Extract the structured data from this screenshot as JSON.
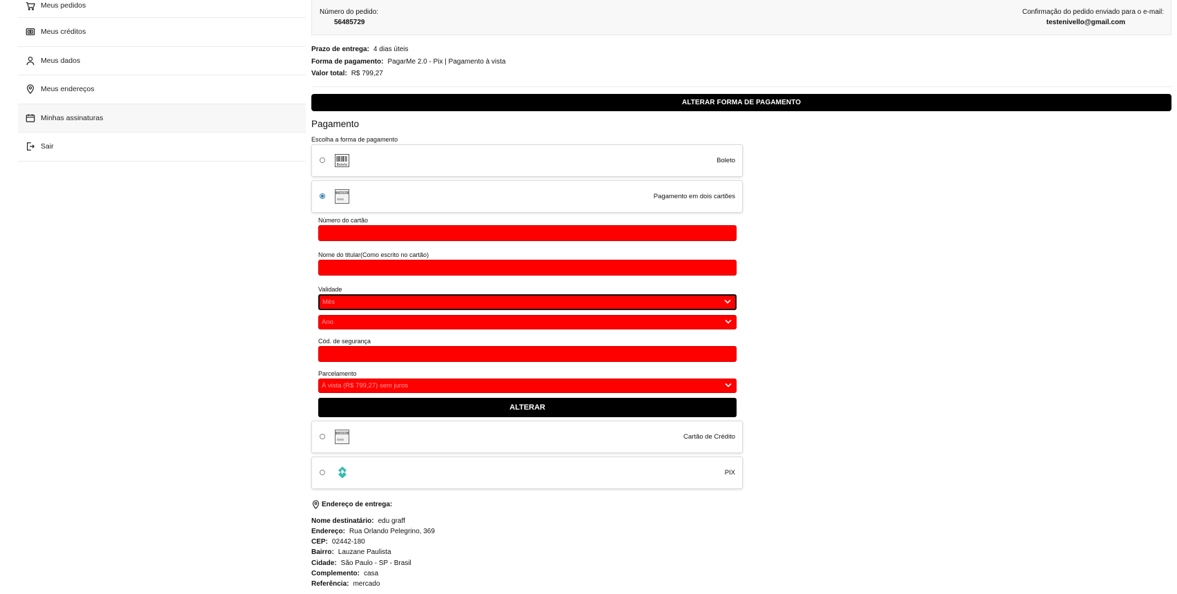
{
  "sidebar": {
    "items": [
      {
        "label": "Meus pedidos",
        "icon": "cart-icon"
      },
      {
        "label": "Meus créditos",
        "icon": "wallet-icon"
      },
      {
        "label": "Meus dados",
        "icon": "user-icon"
      },
      {
        "label": "Meus endereços",
        "icon": "map-pin-icon"
      },
      {
        "label": "Minhas assinaturas",
        "icon": "calendar-icon"
      },
      {
        "label": "Sair",
        "icon": "logout-icon"
      }
    ]
  },
  "order": {
    "number_label": "Número do pedido:",
    "number_value": "56485729",
    "confirmation_label": "Confirmação do pedido enviado para o e-mail:",
    "confirmation_email": "testenivello@gmail.com"
  },
  "info": {
    "prazo_label": "Prazo de entrega:",
    "prazo_value": "4 dias úteis",
    "forma_label": "Forma de pagamento:",
    "forma_value": "PagarMe 2.0 - Pix | Pagamento à vista",
    "valor_label": "Valor total:",
    "valor_value": "R$ 799,27"
  },
  "alter_payment_button": "ALTERAR FORMA DE PAGAMENTO",
  "payment": {
    "title": "Pagamento",
    "choose_label": "Escolha a forma de pagamento",
    "options": [
      {
        "label": "Boleto",
        "icon_text": "Boleto",
        "selected": false
      },
      {
        "label": "Pagamento em dois cartões",
        "icon_text": "Crédito",
        "selected": true
      },
      {
        "label": "Cartão de Crédito",
        "icon_text": "Crédito",
        "selected": false
      },
      {
        "label": "PIX",
        "selected": false
      }
    ],
    "form": {
      "card_number_label": "Número do cartão",
      "holder_label": "Nome do titular(Como escrito no cartão)",
      "validity_label": "Validade",
      "month_placeholder": "Mês",
      "year_placeholder": "Ano",
      "cvv_label": "Cód. de segurança",
      "installments_label": "Parcelamento",
      "installments_value": "À vista (R$ 799,27) sem juros",
      "submit_label": "ALTERAR"
    },
    "error_color": "#ff0000"
  },
  "address": {
    "heading": "Endereço de entrega:",
    "lines": [
      {
        "label": "Nome destinatário:",
        "value": "edu graff"
      },
      {
        "label": "Endereço:",
        "value": "Rua Orlando Pelegrino, 369"
      },
      {
        "label": "CEP:",
        "value": "02442-180"
      },
      {
        "label": "Bairro:",
        "value": "Lauzane Paulista"
      },
      {
        "label": "Cidade:",
        "value": "São Paulo - SP - Brasil"
      },
      {
        "label": "Complemento:",
        "value": "casa"
      },
      {
        "label": "Referência:",
        "value": "mercado"
      }
    ]
  }
}
